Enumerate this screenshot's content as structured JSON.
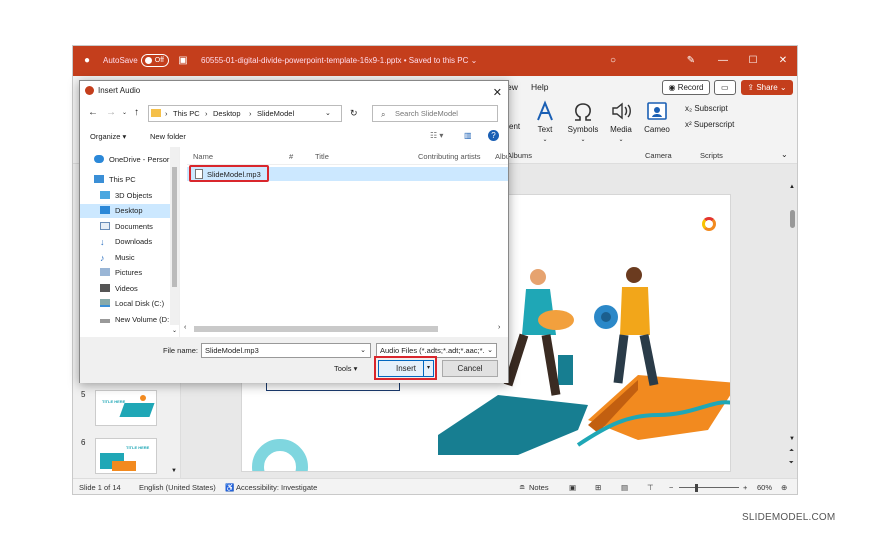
{
  "titlebar": {
    "autosave_label": "AutoSave",
    "autosave_state": "Off",
    "doc_title": "60555-01-digital-divide-powerpoint-template-16x9-1.pptx • Saved to this PC ⌄"
  },
  "ribbon": {
    "tab_partial": "ew",
    "tab_help": "Help",
    "record_label": "Record",
    "share_label": "Share",
    "buttons": {
      "content_partial": "ent",
      "text": "Text",
      "symbols": "Symbols",
      "media": "Media",
      "cameo": "Cameo",
      "subscript": "Subscript",
      "superscript": "Superscript"
    },
    "groups": {
      "albums_partial": "Albums",
      "camera": "Camera",
      "scripts": "Scripts"
    }
  },
  "dialog": {
    "title": "Insert Audio",
    "breadcrumb": [
      "This PC",
      "Desktop",
      "SlideModel"
    ],
    "search_placeholder": "Search SlideModel",
    "organize_label": "Organize ▾",
    "new_folder_label": "New folder",
    "nav_items": [
      {
        "label": "OneDrive - Persor",
        "icon": "cloud-icon"
      },
      {
        "label": "This PC",
        "icon": "computer-icon"
      },
      {
        "label": "3D Objects",
        "icon": "cube-icon"
      },
      {
        "label": "Desktop",
        "icon": "desktop-icon"
      },
      {
        "label": "Documents",
        "icon": "document-icon"
      },
      {
        "label": "Downloads",
        "icon": "download-icon"
      },
      {
        "label": "Music",
        "icon": "music-icon"
      },
      {
        "label": "Pictures",
        "icon": "picture-icon"
      },
      {
        "label": "Videos",
        "icon": "video-icon"
      },
      {
        "label": "Local Disk (C:)",
        "icon": "disk-icon"
      },
      {
        "label": "New Volume (D:",
        "icon": "drive-icon"
      }
    ],
    "columns": [
      "Name",
      "#",
      "Title",
      "Contributing artists",
      "Album"
    ],
    "files": [
      {
        "name": "SlideModel.mp3"
      }
    ],
    "filename_label": "File name:",
    "filename_value": "SlideModel.mp3",
    "filetype_value": "Audio Files (*.adts;*.adt;*.aac;*.",
    "tools_label": "Tools",
    "insert_label": "Insert",
    "cancel_label": "Cancel"
  },
  "thumbnails": [
    {
      "number": "5",
      "title": "TITLE HERE"
    },
    {
      "number": "6",
      "title": "TITLE HERE"
    }
  ],
  "statusbar": {
    "slide_info": "Slide 1 of 14",
    "language": "English (United States)",
    "accessibility": "Accessibility: Investigate",
    "notes": "Notes",
    "zoom": "60%"
  },
  "watermark": "SLIDEMODEL.COM",
  "colors": {
    "accent": "#c43e1c",
    "highlight_red": "#d9262c",
    "selection_blue": "#cce8ff",
    "teal": "#1fa7b6",
    "orange": "#f28a1f"
  }
}
